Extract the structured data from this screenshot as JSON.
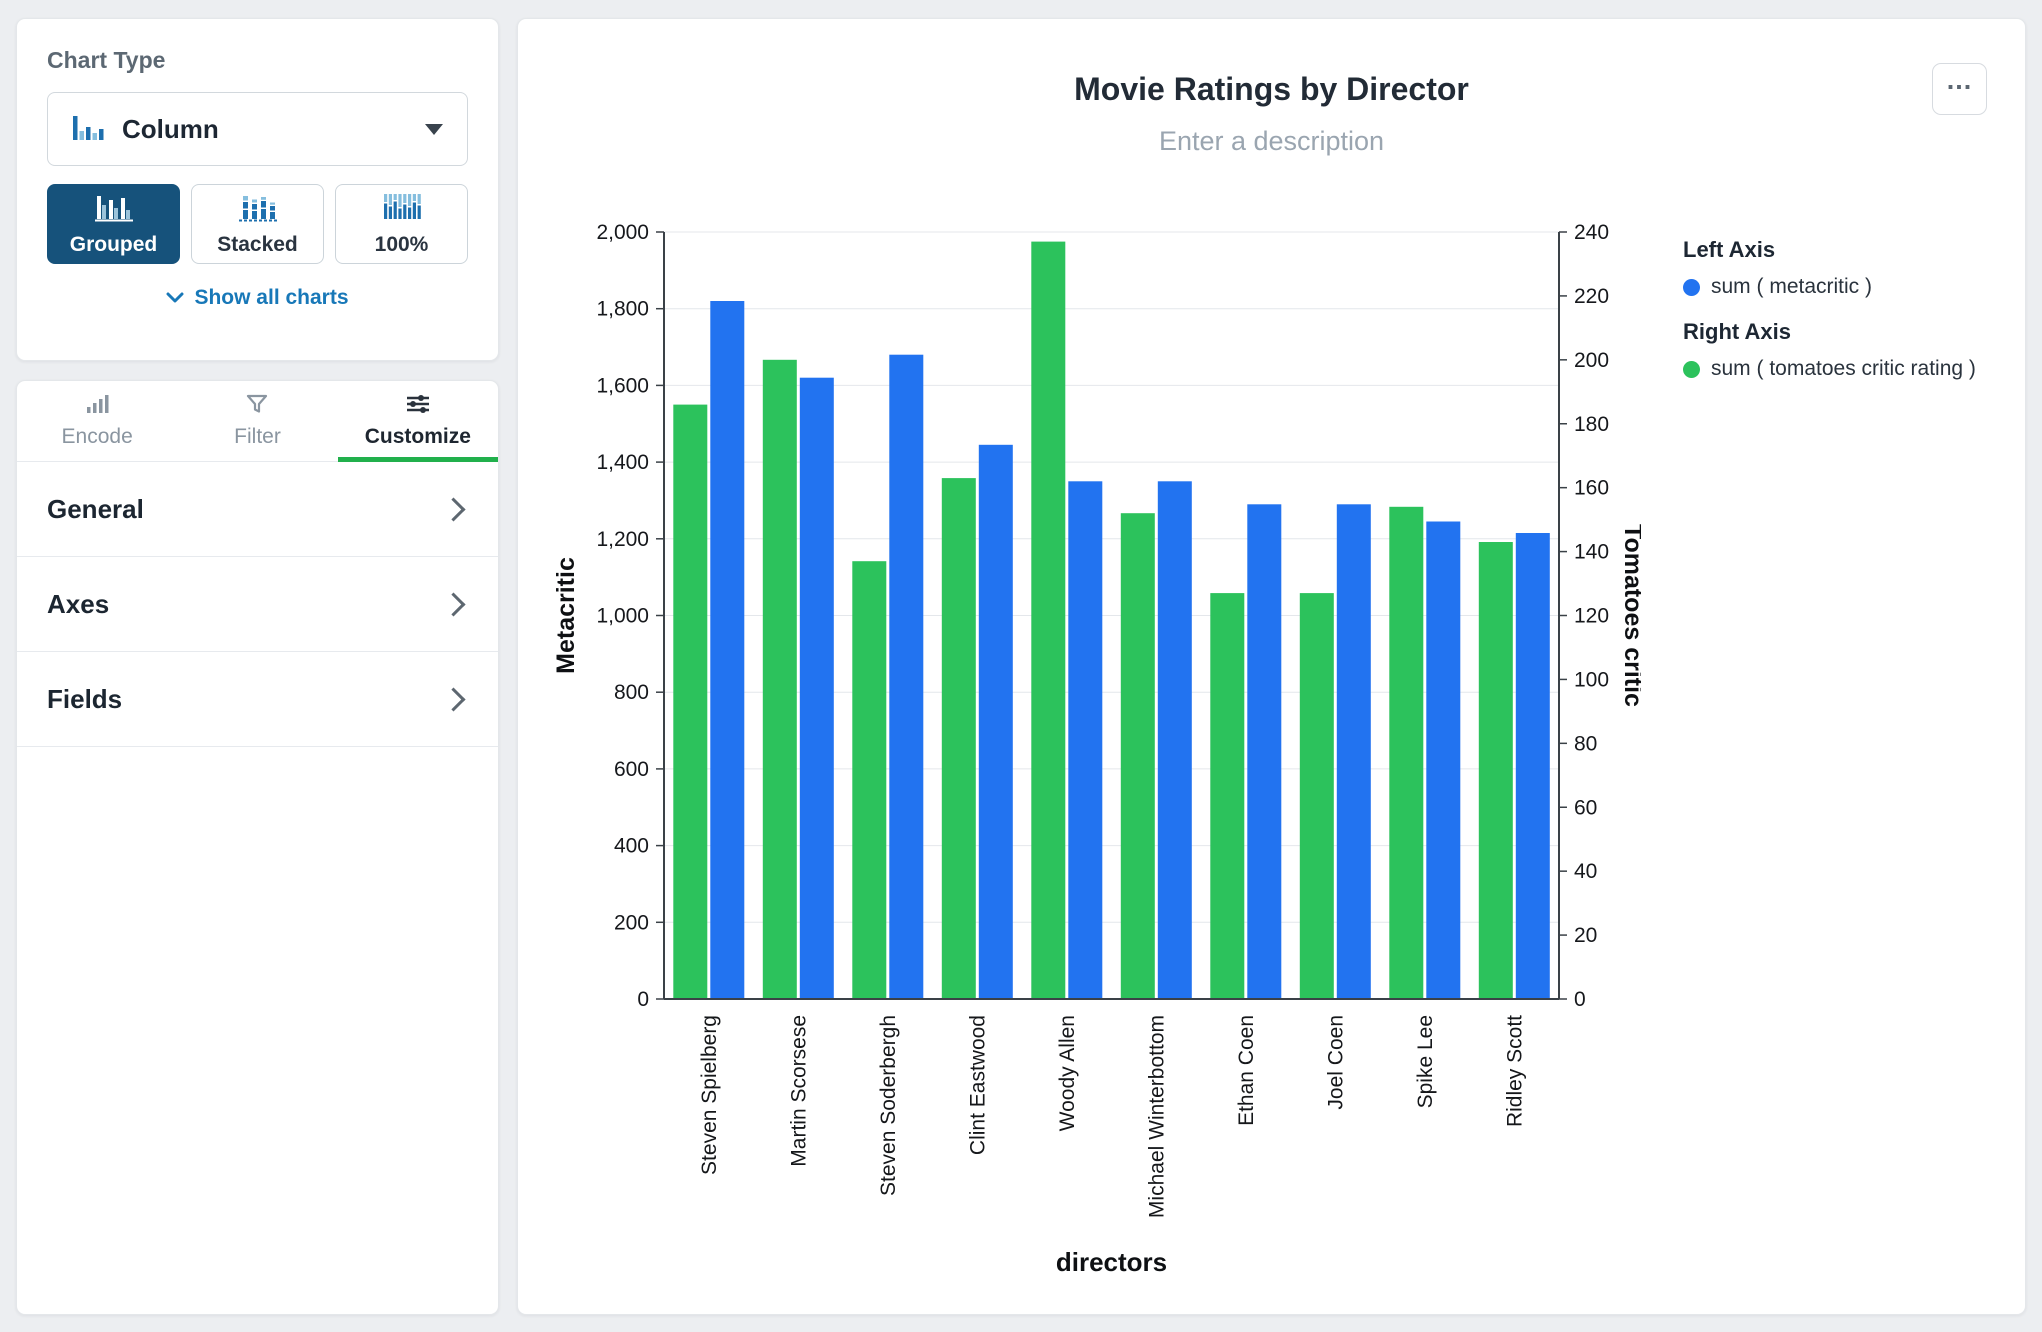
{
  "sidebar": {
    "chart_type": {
      "heading": "Chart Type",
      "selector": {
        "value": "Column",
        "icon": "column-chart-icon"
      },
      "subtypes": [
        {
          "label": "Grouped",
          "selected": true,
          "icon": "grouped-bars-icon"
        },
        {
          "label": "Stacked",
          "selected": false,
          "icon": "stacked-bars-icon"
        },
        {
          "label": "100%",
          "selected": false,
          "icon": "percent-bars-icon"
        }
      ],
      "show_all_label": "Show all charts",
      "show_all_icon": "chevron-down-icon"
    },
    "tabs": [
      {
        "label": "Encode",
        "icon": "bars-icon",
        "active": false
      },
      {
        "label": "Filter",
        "icon": "funnel-icon",
        "active": false
      },
      {
        "label": "Customize",
        "icon": "sliders-icon",
        "active": true
      }
    ],
    "sections": [
      {
        "label": "General"
      },
      {
        "label": "Axes"
      },
      {
        "label": "Fields"
      }
    ]
  },
  "main": {
    "title": "Movie Ratings by Director",
    "description_placeholder": "Enter a description",
    "menu_label": "...",
    "legend": {
      "left_heading": "Left Axis",
      "left_item": "sum ( metacritic )",
      "right_heading": "Right Axis",
      "right_item": "sum ( tomatoes critic rating )"
    }
  },
  "chart_data": {
    "type": "bar",
    "title": "Movie Ratings by Director",
    "xlabel": "directors",
    "categories": [
      "Steven Spielberg",
      "Martin Scorsese",
      "Steven Soderbergh",
      "Clint Eastwood",
      "Woody Allen",
      "Michael Winterbottom",
      "Ethan Coen",
      "Joel Coen",
      "Spike Lee",
      "Ridley Scott"
    ],
    "left_axis": {
      "label": "Metacritic",
      "min": 0,
      "max": 2000,
      "step": 200
    },
    "right_axis": {
      "label": "Tomatoes critic",
      "min": 0,
      "max": 240,
      "step": 20
    },
    "grid": true,
    "legend_position": "right",
    "series": [
      {
        "name": "sum ( tomatoes critic rating )",
        "axis": "right",
        "color": "#2cc25c",
        "values": [
          186,
          200,
          137,
          163,
          237,
          152,
          127,
          127,
          154,
          143
        ]
      },
      {
        "name": "sum ( metacritic )",
        "axis": "left",
        "color": "#2273f0",
        "values": [
          1820,
          1620,
          1680,
          1445,
          1350,
          1350,
          1290,
          1290,
          1245,
          1215
        ]
      }
    ]
  },
  "colors": {
    "accent_blue": "#2273f0",
    "accent_green": "#2cc25c",
    "selected_subtype_bg": "#16527b",
    "link_blue": "#1878b8",
    "active_tab_underline": "#21b04c"
  }
}
